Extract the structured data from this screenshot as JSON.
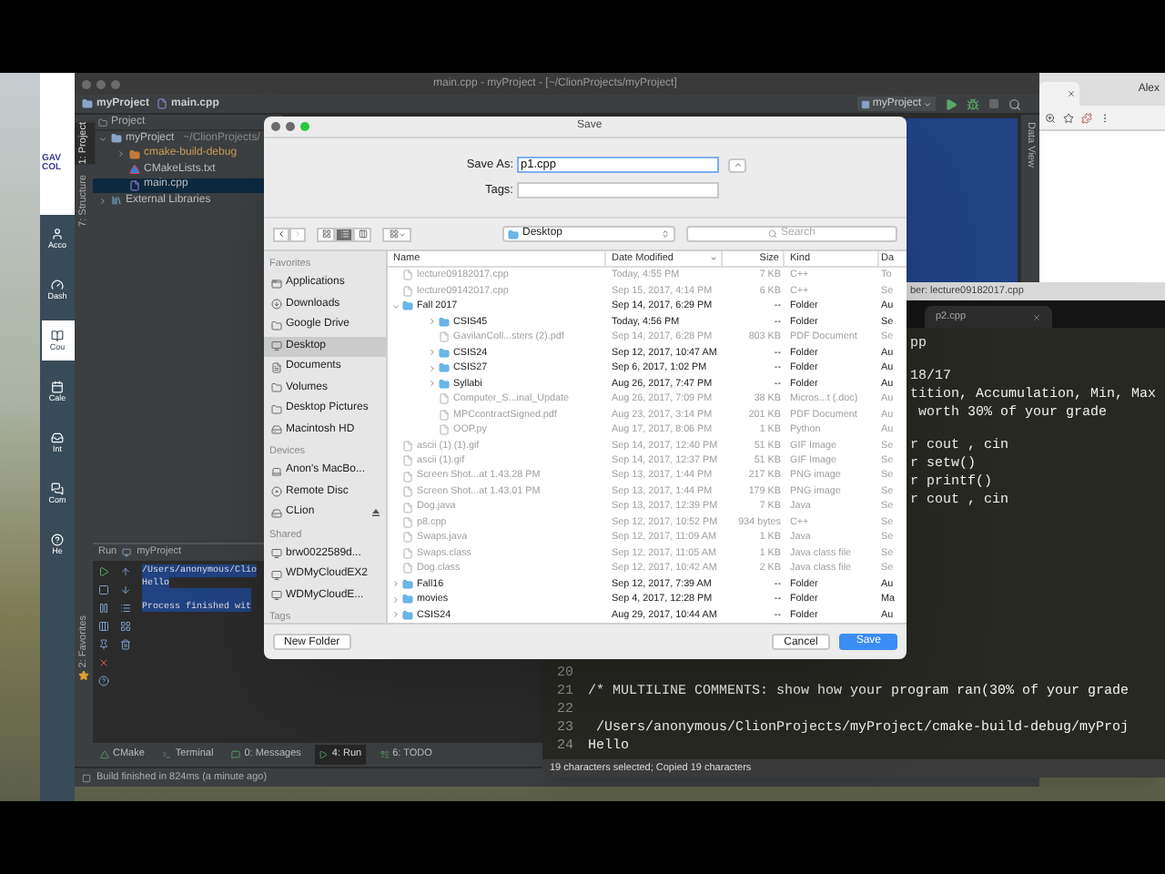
{
  "browser": {
    "logo": [
      "GAV",
      "COL"
    ],
    "nav": [
      {
        "label": "Acco",
        "selected": false
      },
      {
        "label": "Dash",
        "selected": false
      },
      {
        "label": "Cou",
        "selected": true
      },
      {
        "label": "Cale",
        "selected": false
      },
      {
        "label": "Int",
        "selected": false
      },
      {
        "label": "Com",
        "selected": false
      },
      {
        "label": "He",
        "selected": false
      }
    ]
  },
  "ide": {
    "title": "main.cpp - myProject - [~/ClionProjects/myProject]",
    "breadcrumb": [
      "myProject",
      "main.cpp"
    ],
    "run_config": "myProject",
    "side_tabs": [
      {
        "label": "1: Project",
        "selected": true
      },
      {
        "label": "7: Structure",
        "selected": false
      }
    ],
    "favorites_tab": "2: Favorites",
    "project_panel": {
      "title": "Project",
      "tree": [
        {
          "kind": "project",
          "name": "myProject",
          "path": "~/ClionProjects/",
          "expanded": true,
          "selected": false,
          "children": [
            {
              "kind": "excluded",
              "name": "cmake-build-debug",
              "expanded": false,
              "selected": false
            },
            {
              "kind": "cmake",
              "name": "CMakeLists.txt",
              "selected": false
            },
            {
              "kind": "source",
              "name": "main.cpp",
              "selected": true
            }
          ]
        },
        {
          "kind": "library",
          "name": "External Libraries",
          "expanded": false,
          "selected": false
        }
      ]
    },
    "data_view_tab": "Data View",
    "run_panel": {
      "title": "Run",
      "config": "myProject",
      "output": [
        [
          "/Users/anonymous/Clio",
          "Hello"
        ],
        [
          "Process finished wit"
        ]
      ]
    },
    "bottom_tabs": [
      {
        "label": "CMake",
        "selected": false
      },
      {
        "label": "Terminal",
        "selected": false
      },
      {
        "label": "0: Messages",
        "selected": false
      },
      {
        "label": "4: Run",
        "selected": true
      },
      {
        "label": "6: TODO",
        "selected": false
      }
    ],
    "status": "Build finished in 824ms (a minute ago)"
  },
  "chrome": {
    "profile": "Alex"
  },
  "editor": {
    "title": "ber: lecture09182017.cpp",
    "tab": "p2.cpp",
    "top_lines": [
      [
        "pp"
      ],
      [
        "18/17",
        "tition, Accumulation, Min, Max",
        " worth 30% of your grade"
      ],
      [
        "r cout , cin",
        "r setw()",
        "r printf()",
        "r cout , cin"
      ]
    ],
    "lines": [
      {
        "number": "20"
      },
      {
        "number": "21",
        "text": "/* MULTILINE COMMENTS: show how your program ran(30% of your grade"
      },
      {
        "number": "22"
      },
      {
        "number": "23",
        "text": " /Users/anonymous/ClionProjects/myProject/cmake-build-debug/myProj"
      },
      {
        "number": "24",
        "text": "Hello"
      }
    ],
    "status": "19 characters selected; Copied 19 characters"
  },
  "save_dialog": {
    "title": "Save",
    "save_as_label": "Save As:",
    "filename": "p1.cpp",
    "tags_label": "Tags:",
    "location": "Desktop",
    "search_placeholder": "Search",
    "view_modes": [
      {
        "selected": false
      },
      {
        "selected": true
      },
      {
        "selected": false
      }
    ],
    "sidebar": [
      {
        "heading": "Favorites",
        "items": [
          {
            "label": "Applications",
            "selected": false,
            "ejectable": false
          },
          {
            "label": "Downloads",
            "selected": false,
            "ejectable": false
          },
          {
            "label": "Google Drive",
            "selected": false,
            "ejectable": false
          },
          {
            "label": "Desktop",
            "selected": true,
            "ejectable": false
          },
          {
            "label": "Documents",
            "selected": false,
            "ejectable": false
          },
          {
            "label": "Volumes",
            "selected": false,
            "ejectable": false
          },
          {
            "label": "Desktop Pictures",
            "selected": false,
            "ejectable": false
          },
          {
            "label": "Macintosh HD",
            "selected": false,
            "ejectable": false
          }
        ]
      },
      {
        "heading": "Devices",
        "items": [
          {
            "label": "Anon's MacBo...",
            "selected": false,
            "ejectable": false
          },
          {
            "label": "Remote Disc",
            "selected": false,
            "ejectable": false
          },
          {
            "label": "CLion",
            "selected": false,
            "ejectable": true
          }
        ]
      },
      {
        "heading": "Shared",
        "items": [
          {
            "label": "brw0022589d...",
            "selected": false,
            "ejectable": false
          },
          {
            "label": "WDMyCloudEX2",
            "selected": false,
            "ejectable": false
          },
          {
            "label": "WDMyCloudE...",
            "selected": false,
            "ejectable": false
          }
        ]
      },
      {
        "heading": "Tags"
      }
    ],
    "columns": [
      "Name",
      "Date Modified",
      "Size",
      "Kind",
      "Da"
    ],
    "rows": [
      {
        "kind": "file",
        "name": "lecture09182017.cpp",
        "date": "Today, 4:55 PM",
        "size": "7 KB",
        "type": "C++",
        "column_5": "To"
      },
      {
        "kind": "file",
        "name": "lecture09142017.cpp",
        "date": "Sep 15, 2017, 4:14 PM",
        "size": "6 KB",
        "type": "C++",
        "column_5": "Se"
      },
      {
        "kind": "folder",
        "name": "Fall 2017",
        "date": "Sep 14, 2017, 6:29 PM",
        "size": "--",
        "type": "Folder",
        "column_5": "Au",
        "expanded": true,
        "children": [
          {
            "kind": "folder",
            "name": "CSIS45",
            "date": "Today, 4:56 PM",
            "size": "--",
            "type": "Folder",
            "column_5": "Se",
            "expanded": false
          },
          {
            "kind": "file",
            "name": "GavilanColl...sters (2).pdf",
            "date": "Sep 14, 2017, 6:28 PM",
            "size": "803 KB",
            "type": "PDF Document",
            "column_5": "Se"
          },
          {
            "kind": "folder",
            "name": "CSIS24",
            "date": "Sep 12, 2017, 10:47 AM",
            "size": "--",
            "type": "Folder",
            "column_5": "Au",
            "expanded": false
          },
          {
            "kind": "folder",
            "name": "CSIS27",
            "date": "Sep 6, 2017, 1:02 PM",
            "size": "--",
            "type": "Folder",
            "column_5": "Au",
            "expanded": false
          },
          {
            "kind": "folder",
            "name": "Syllabi",
            "date": "Aug 26, 2017, 7:47 PM",
            "size": "--",
            "type": "Folder",
            "column_5": "Au",
            "expanded": false
          },
          {
            "kind": "file",
            "name": "Computer_S...inal_Update",
            "date": "Aug 26, 2017, 7:09 PM",
            "size": "38 KB",
            "type": "Micros...t (.doc)",
            "column_5": "Au"
          },
          {
            "kind": "file",
            "name": "MPCcontractSigned.pdf",
            "date": "Aug 23, 2017, 3:14 PM",
            "size": "201 KB",
            "type": "PDF Document",
            "column_5": "Au"
          },
          {
            "kind": "file",
            "name": "OOP.py",
            "date": "Aug 17, 2017, 8:06 PM",
            "size": "1 KB",
            "type": "Python",
            "column_5": "Au"
          }
        ]
      },
      {
        "kind": "file",
        "name": "ascii (1) (1).gif",
        "date": "Sep 14, 2017, 12:40 PM",
        "size": "51 KB",
        "type": "GIF Image",
        "column_5": "Se"
      },
      {
        "kind": "file",
        "name": "ascii (1).gif",
        "date": "Sep 14, 2017, 12:37 PM",
        "size": "51 KB",
        "type": "GIF Image",
        "column_5": "Se"
      },
      {
        "kind": "file",
        "name": "Screen Shot...at 1.43.28 PM",
        "date": "Sep 13, 2017, 1:44 PM",
        "size": "217 KB",
        "type": "PNG image",
        "column_5": "Se"
      },
      {
        "kind": "file",
        "name": "Screen Shot...at 1.43.01 PM",
        "date": "Sep 13, 2017, 1:44 PM",
        "size": "179 KB",
        "type": "PNG image",
        "column_5": "Se"
      },
      {
        "kind": "file",
        "name": "Dog.java",
        "date": "Sep 13, 2017, 12:39 PM",
        "size": "7 KB",
        "type": "Java",
        "column_5": "Se"
      },
      {
        "kind": "file",
        "name": "p8.cpp",
        "date": "Sep 12, 2017, 10:52 PM",
        "size": "934 bytes",
        "type": "C++",
        "column_5": "Se"
      },
      {
        "kind": "file",
        "name": "Swaps.java",
        "date": "Sep 12, 2017, 11:09 AM",
        "size": "1 KB",
        "type": "Java",
        "column_5": "Se"
      },
      {
        "kind": "file",
        "name": "Swaps.class",
        "date": "Sep 12, 2017, 11:05 AM",
        "size": "1 KB",
        "type": "Java class file",
        "column_5": "Se"
      },
      {
        "kind": "file",
        "name": "Dog.class",
        "date": "Sep 12, 2017, 10:42 AM",
        "size": "2 KB",
        "type": "Java class file",
        "column_5": "Se"
      },
      {
        "kind": "folder",
        "name": "Fall16",
        "date": "Sep 12, 2017, 7:39 AM",
        "size": "--",
        "type": "Folder",
        "column_5": "Au",
        "expanded": false
      },
      {
        "kind": "folder",
        "name": "movies",
        "date": "Sep 4, 2017, 12:28 PM",
        "size": "--",
        "type": "Folder",
        "column_5": "Ma",
        "expanded": false
      },
      {
        "kind": "folder",
        "name": "CSIS24",
        "date": "Aug 29, 2017, 10:44 AM",
        "size": "--",
        "type": "Folder",
        "column_5": "Au",
        "expanded": false
      }
    ],
    "buttons": {
      "new_folder": "New Folder",
      "cancel": "Cancel",
      "save": "Save"
    }
  }
}
